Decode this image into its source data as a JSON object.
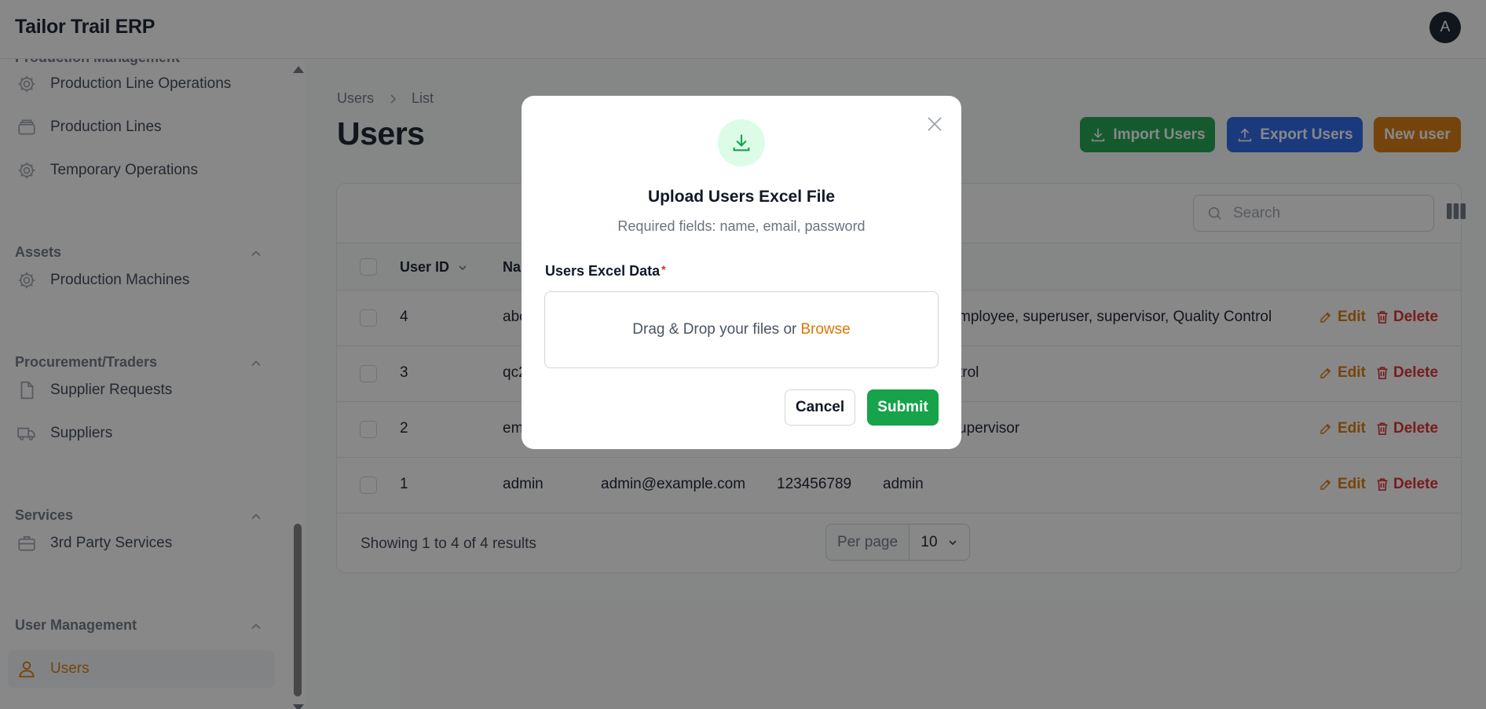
{
  "app": {
    "title": "Tailor Trail ERP",
    "avatar_initial": "A"
  },
  "sidebar": {
    "clipped_group": "Production Management",
    "items_production": [
      {
        "label": "Production Line Operations",
        "icon": "cog-icon"
      },
      {
        "label": "Production Lines",
        "icon": "layers-icon"
      },
      {
        "label": "Temporary Operations",
        "icon": "cog-icon"
      }
    ],
    "group_assets": "Assets",
    "items_assets": [
      {
        "label": "Production Machines",
        "icon": "cog-icon"
      }
    ],
    "group_procurement": "Procurement/Traders",
    "items_procurement": [
      {
        "label": "Supplier Requests",
        "icon": "document-icon"
      },
      {
        "label": "Suppliers",
        "icon": "truck-icon"
      }
    ],
    "group_services": "Services",
    "items_services": [
      {
        "label": "3rd Party Services",
        "icon": "briefcase-icon"
      }
    ],
    "group_users": "User Management",
    "items_users": [
      {
        "label": "Users",
        "icon": "user-icon",
        "active": true
      }
    ]
  },
  "breadcrumb": {
    "first": "Users",
    "second": "List"
  },
  "page": {
    "title": "Users"
  },
  "actions": {
    "import": "Import Users",
    "export": "Export Users",
    "new": "New user"
  },
  "table": {
    "search_placeholder": "Search",
    "headers": {
      "id": "User ID",
      "name": "Na"
    },
    "rows": [
      {
        "id": "4",
        "name": "abc",
        "email": "",
        "phone": "",
        "roles": "mployee, superuser, supervisor, Quality Control"
      },
      {
        "id": "3",
        "name": "qc2",
        "email": "",
        "phone": "",
        "roles": "trol"
      },
      {
        "id": "2",
        "name": "em",
        "email": "",
        "phone": "",
        "roles": "upervisor"
      },
      {
        "id": "1",
        "name": "admin",
        "email": "admin@example.com",
        "phone": "123456789",
        "roles": "admin"
      }
    ],
    "row_actions": {
      "edit": "Edit",
      "delete": "Delete"
    },
    "footer": "Showing 1 to 4 of 4 results",
    "per_page_label": "Per page",
    "per_page_value": "10"
  },
  "modal": {
    "title": "Upload Users Excel File",
    "subtitle": "Required fields: name, email, password",
    "field_label": "Users Excel Data",
    "required_mark": "*",
    "dropzone_text": "Drag & Drop your files or",
    "browse": "Browse",
    "cancel": "Cancel",
    "submit": "Submit"
  },
  "colors": {
    "accent": "#d97706",
    "import": "#16a34a",
    "export": "#2563eb",
    "danger": "#dc2626"
  }
}
